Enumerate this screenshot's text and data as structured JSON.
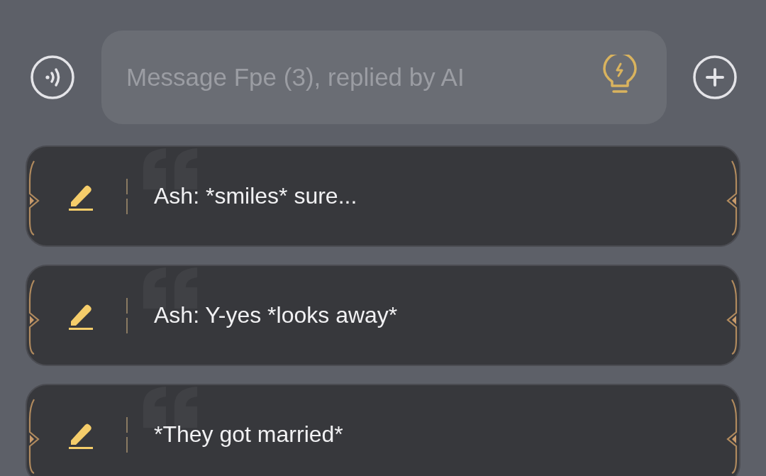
{
  "composer": {
    "placeholder": "Message Fpe (3), replied by AI"
  },
  "suggestions": [
    {
      "text": "Ash: *smiles* sure..."
    },
    {
      "text": "Ash: Y-yes *looks away*"
    },
    {
      "text": "*They got married*"
    }
  ]
}
